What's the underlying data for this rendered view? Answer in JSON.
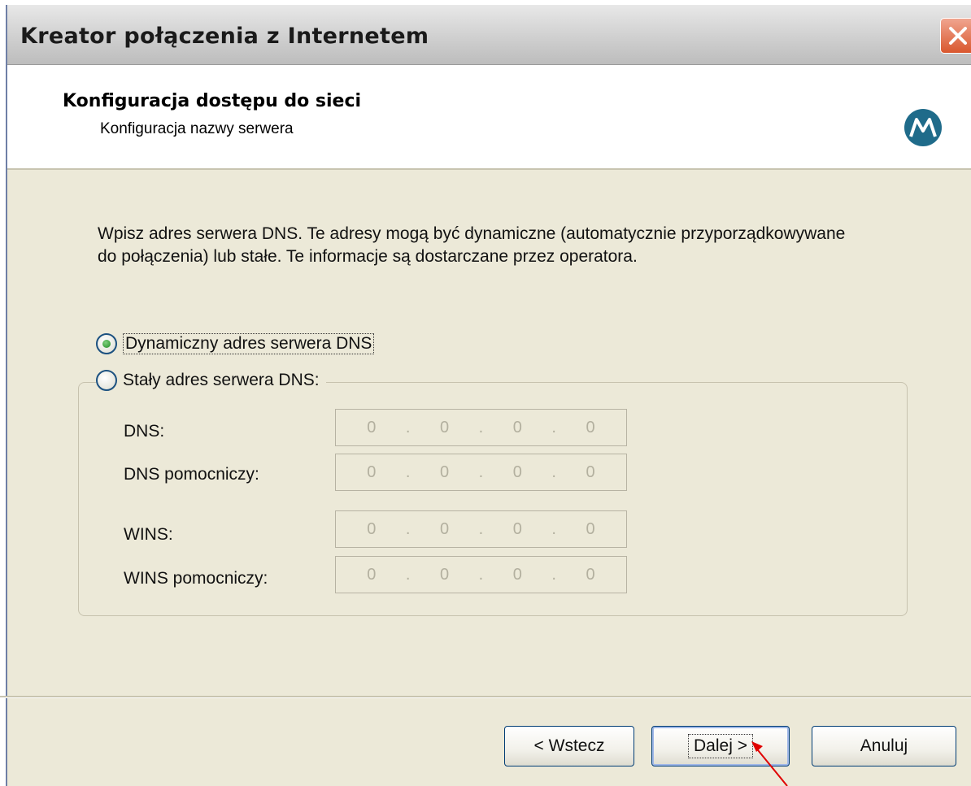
{
  "window": {
    "title": "Kreator połączenia z Internetem"
  },
  "header": {
    "title": "Konfiguracja dostępu do sieci",
    "subtitle": "Konfiguracja nazwy serwera"
  },
  "description": "Wpisz adres serwera DNS. Te adresy mogą być dynamiczne (automatycznie przyporządkowywane do połączenia) lub stałe. Te informacje są dostarczane przez operatora.",
  "options": {
    "dynamic": {
      "label": "Dynamiczny adres serwera DNS",
      "checked": true
    },
    "static": {
      "label": "Stały adres serwera DNS:",
      "checked": false
    }
  },
  "fields": [
    {
      "label": "DNS:",
      "octets": [
        "0",
        "0",
        "0",
        "0"
      ]
    },
    {
      "label": "DNS pomocniczy:",
      "octets": [
        "0",
        "0",
        "0",
        "0"
      ]
    },
    {
      "label": "WINS:",
      "octets": [
        "0",
        "0",
        "0",
        "0"
      ]
    },
    {
      "label": "WINS pomocniczy:",
      "octets": [
        "0",
        "0",
        "0",
        "0"
      ]
    }
  ],
  "buttons": {
    "back": "< Wstecz",
    "next": "Dalej >",
    "cancel": "Anuluj"
  },
  "colors": {
    "annotation_arrow": "#e00000",
    "logo": "#1f6b8a"
  },
  "icons": {
    "close": "close-icon",
    "logo": "motorola-logo-icon"
  }
}
